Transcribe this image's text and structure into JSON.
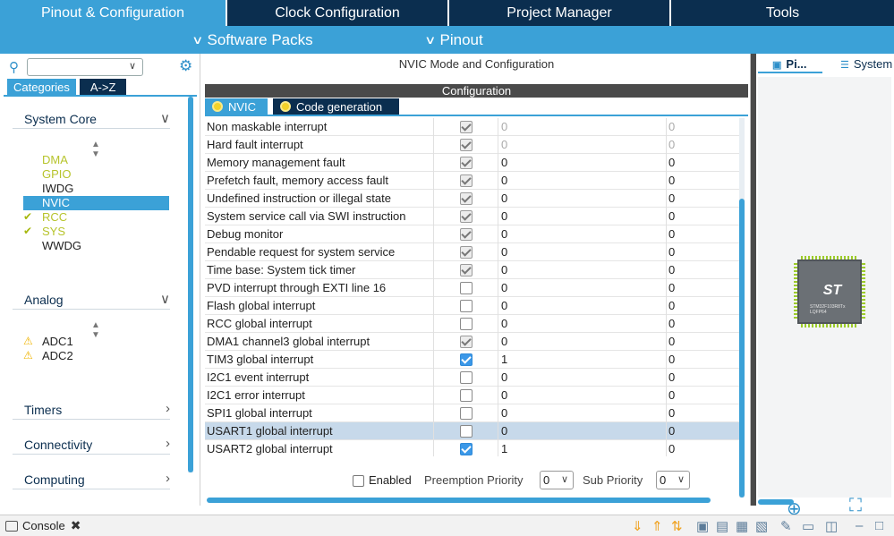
{
  "top_tabs": [
    "Pinout & Configuration",
    "Clock Configuration",
    "Project Manager",
    "Tools"
  ],
  "sub_menu": {
    "software_packs": "Software Packs",
    "pinout": "Pinout"
  },
  "left": {
    "search_placeholder": "",
    "cat_tabs": [
      "Categories",
      "A->Z"
    ],
    "system_core": {
      "label": "System Core",
      "items": [
        {
          "name": "DMA",
          "status": "ok"
        },
        {
          "name": "GPIO",
          "status": "ok"
        },
        {
          "name": "IWDG",
          "status": ""
        },
        {
          "name": "NVIC",
          "status": "selected"
        },
        {
          "name": "RCC",
          "status": "check"
        },
        {
          "name": "SYS",
          "status": "check"
        },
        {
          "name": "WWDG",
          "status": ""
        }
      ]
    },
    "analog": {
      "label": "Analog",
      "items": [
        "ADC1",
        "ADC2"
      ]
    },
    "timers": "Timers",
    "connectivity": "Connectivity",
    "computing": "Computing"
  },
  "center": {
    "title": "NVIC Mode and Configuration",
    "config_label": "Configuration",
    "tabs": [
      "NVIC",
      "Code generation"
    ],
    "rows": [
      {
        "name": "Non maskable interrupt",
        "enabled": "locked",
        "pre": "0",
        "sub": "0",
        "disabled": true
      },
      {
        "name": "Hard fault interrupt",
        "enabled": "locked",
        "pre": "0",
        "sub": "0",
        "disabled": true
      },
      {
        "name": "Memory management fault",
        "enabled": "locked",
        "pre": "0",
        "sub": "0"
      },
      {
        "name": "Prefetch fault, memory access fault",
        "enabled": "locked",
        "pre": "0",
        "sub": "0"
      },
      {
        "name": "Undefined instruction or illegal state",
        "enabled": "locked",
        "pre": "0",
        "sub": "0"
      },
      {
        "name": "System service call via SWI instruction",
        "enabled": "locked",
        "pre": "0",
        "sub": "0"
      },
      {
        "name": "Debug monitor",
        "enabled": "locked",
        "pre": "0",
        "sub": "0"
      },
      {
        "name": "Pendable request for system service",
        "enabled": "locked",
        "pre": "0",
        "sub": "0"
      },
      {
        "name": "Time base: System tick timer",
        "enabled": "locked",
        "pre": "0",
        "sub": "0"
      },
      {
        "name": "PVD interrupt through EXTI line 16",
        "enabled": "off",
        "pre": "0",
        "sub": "0"
      },
      {
        "name": "Flash global interrupt",
        "enabled": "off",
        "pre": "0",
        "sub": "0"
      },
      {
        "name": "RCC global interrupt",
        "enabled": "off",
        "pre": "0",
        "sub": "0"
      },
      {
        "name": "DMA1 channel3 global interrupt",
        "enabled": "locked",
        "pre": "0",
        "sub": "0"
      },
      {
        "name": "TIM3 global interrupt",
        "enabled": "on",
        "pre": "1",
        "sub": "0"
      },
      {
        "name": "I2C1 event interrupt",
        "enabled": "off",
        "pre": "0",
        "sub": "0"
      },
      {
        "name": "I2C1 error interrupt",
        "enabled": "off",
        "pre": "0",
        "sub": "0"
      },
      {
        "name": "SPI1 global interrupt",
        "enabled": "off",
        "pre": "0",
        "sub": "0"
      },
      {
        "name": "USART1 global interrupt",
        "enabled": "off",
        "pre": "0",
        "sub": "0",
        "selected": true
      },
      {
        "name": "USART2 global interrupt",
        "enabled": "on",
        "pre": "1",
        "sub": "0"
      }
    ],
    "enabled_label": "Enabled",
    "preemption_label": "Preemption Priority",
    "preemption_value": "0",
    "sub_priority_label": "Sub Priority",
    "sub_priority_value": "0"
  },
  "right": {
    "tabs": [
      "Pi...",
      "System"
    ],
    "chip_text": "STM32F103R8Tx",
    "chip_package": "LQFP64"
  },
  "console": {
    "label": "Console"
  },
  "colors": {
    "navy": "#0b2e4f",
    "accent": "#3ba1d7",
    "ok": "#b7c42c",
    "warn": "#f0b400"
  }
}
